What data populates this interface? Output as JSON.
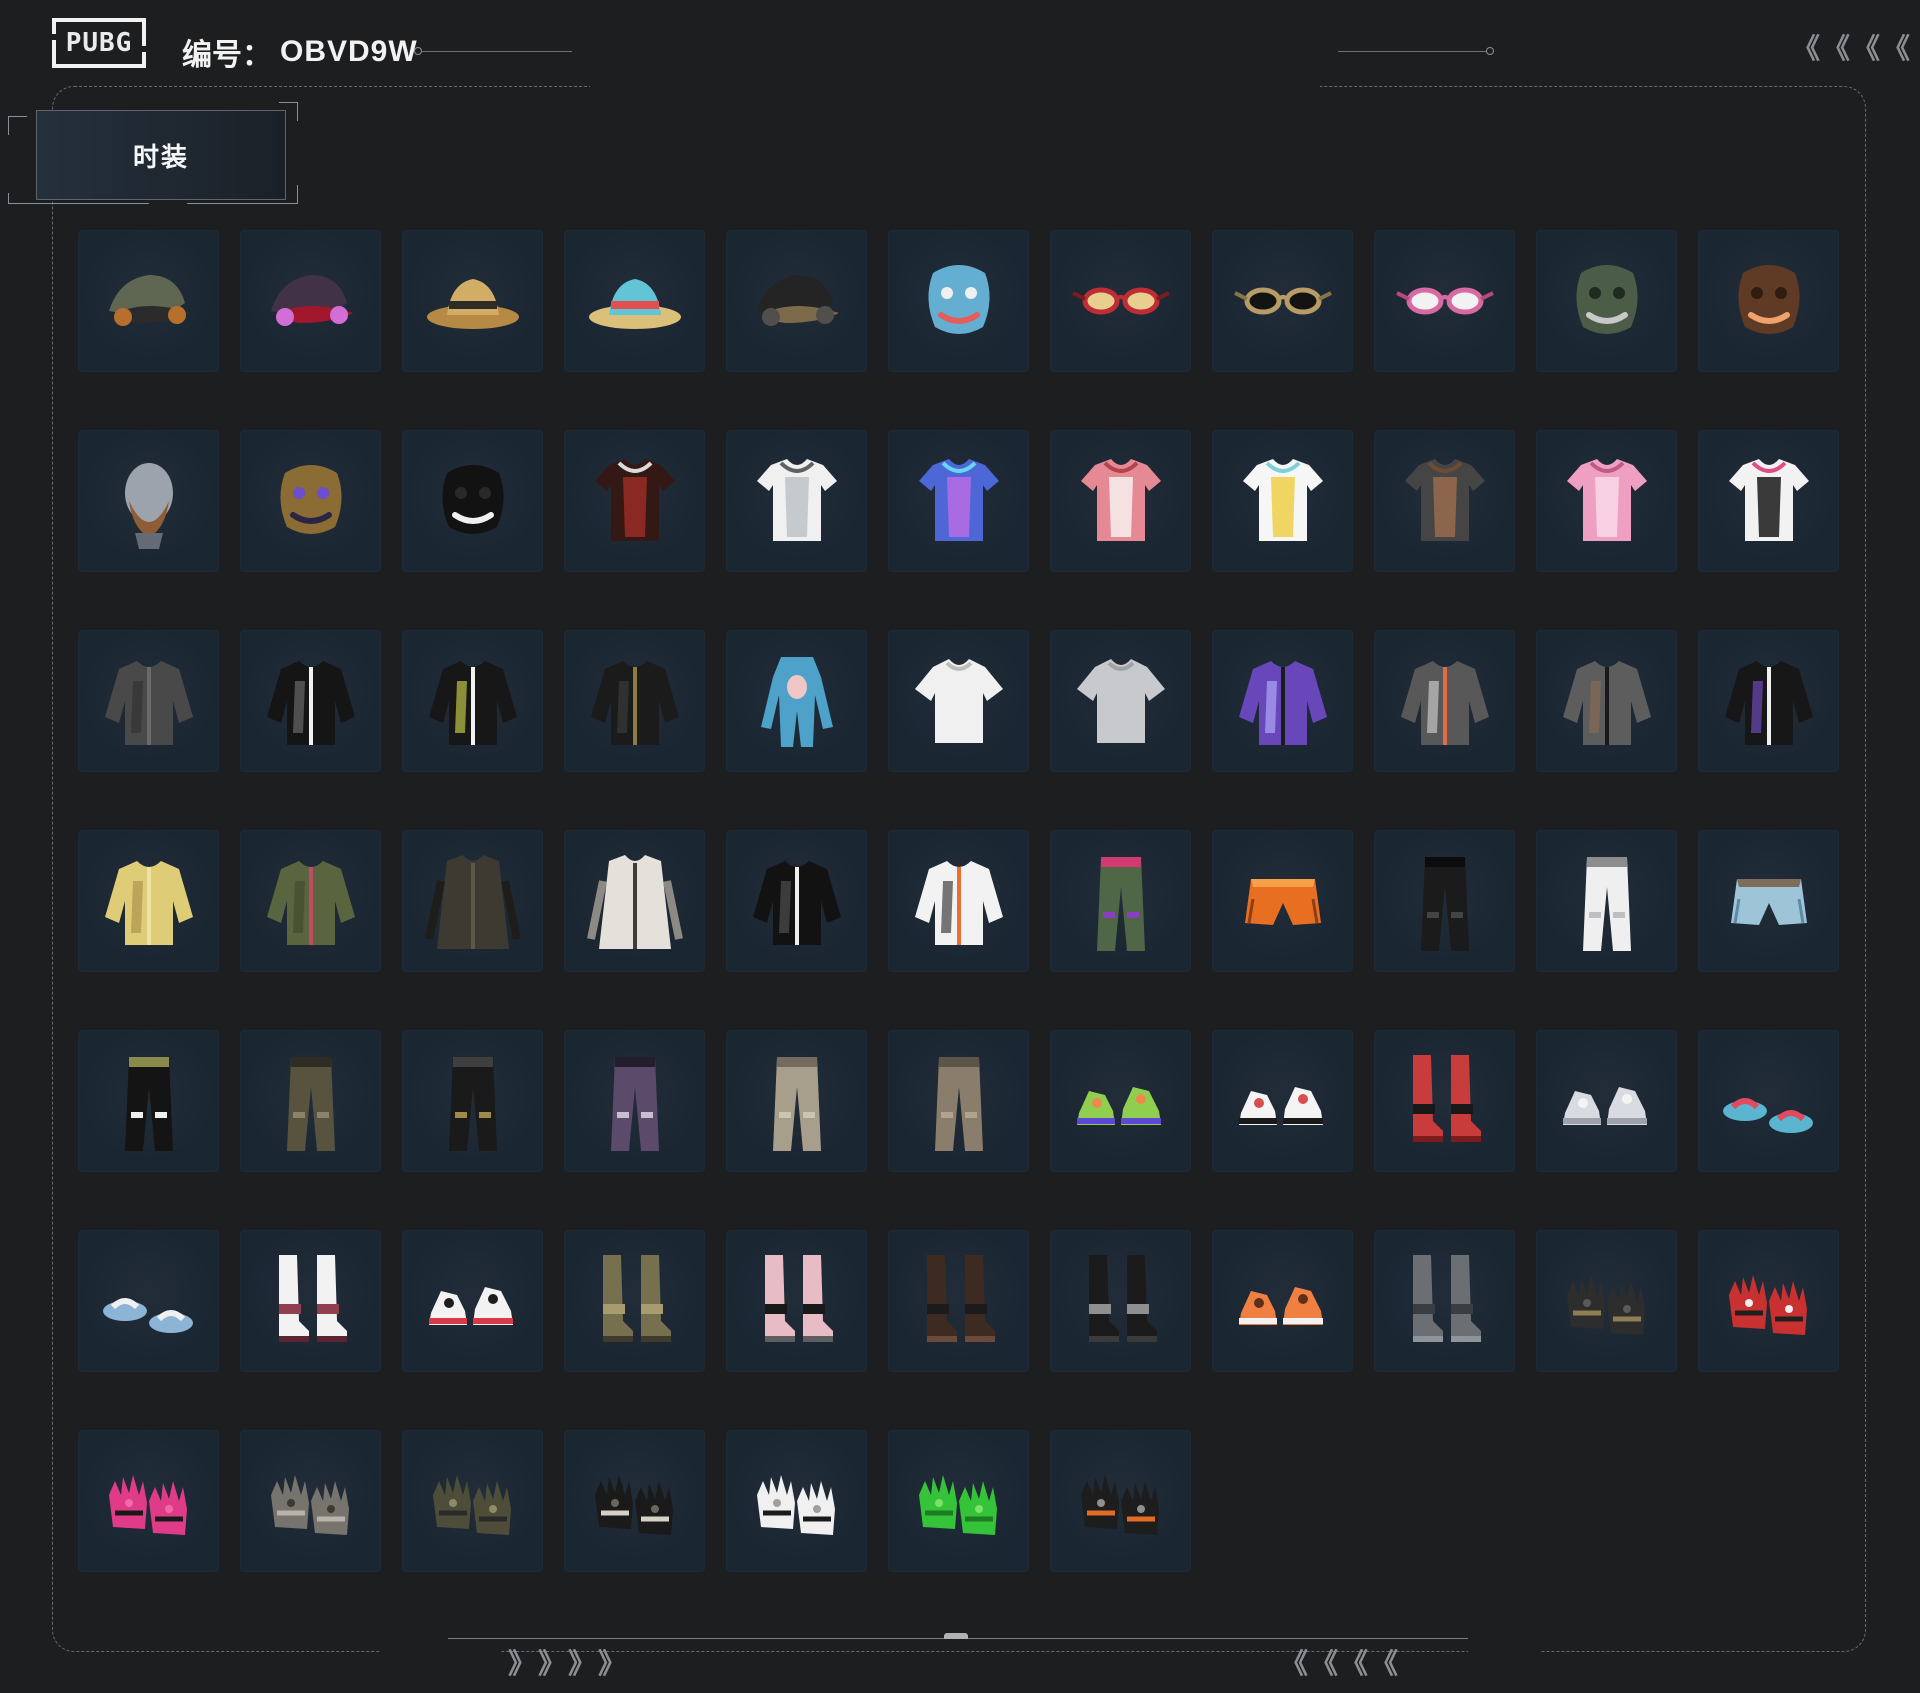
{
  "header": {
    "logo_text": "PUBG",
    "account_label": "编号：",
    "account_id": "OBVD9W"
  },
  "tabs": [
    {
      "label": "时装",
      "selected": true
    }
  ],
  "colors": {
    "background": "#1d1e20",
    "tile": "#1b2633",
    "frame": "#676a6e",
    "accent_text": "#f2f2f2"
  },
  "decor": {
    "top_right_arrows": [
      "《",
      "《",
      "《",
      "《"
    ],
    "bottom_left_arrows": [
      "》",
      "》",
      "》",
      "》"
    ],
    "bottom_right_arrows": [
      "《",
      "《",
      "《",
      "《"
    ]
  },
  "items": [
    {
      "name": "military-cap-headset-icon",
      "kind": "cap",
      "palette": [
        "#5f6753",
        "#b66f2d",
        "#2b2b2b"
      ]
    },
    {
      "name": "cat-ear-goggles-icon",
      "kind": "cap",
      "palette": [
        "#413245",
        "#d26ed6",
        "#a0172e"
      ]
    },
    {
      "name": "bucket-hat-icon",
      "kind": "hat",
      "palette": [
        "#b68a44",
        "#2e2b28",
        "#d2ad65"
      ]
    },
    {
      "name": "sun-hat-icon",
      "kind": "hat",
      "palette": [
        "#dbc07a",
        "#e14f4f",
        "#61c4d7"
      ]
    },
    {
      "name": "black-cap-icon",
      "kind": "cap",
      "palette": [
        "#242424",
        "#514f4b",
        "#7d6a4b"
      ]
    },
    {
      "name": "dino-mask-icon",
      "kind": "mask",
      "palette": [
        "#64afd1",
        "#e45d5d",
        "#f0f0f0"
      ]
    },
    {
      "name": "red-glasses-icon",
      "kind": "glasses",
      "palette": [
        "#bf2d34",
        "#e8cf90",
        "#7b1d1d"
      ]
    },
    {
      "name": "gold-sunglasses-icon",
      "kind": "glasses",
      "palette": [
        "#b89c66",
        "#131313",
        "#8a7447"
      ]
    },
    {
      "name": "visor-glasses-icon",
      "kind": "glasses",
      "palette": [
        "#d76aa2",
        "#f2f2f2",
        "#b44c78"
      ]
    },
    {
      "name": "face-bandana-icon",
      "kind": "mask",
      "palette": [
        "#4b5d46",
        "#c9c9c9",
        "#1f2b20"
      ]
    },
    {
      "name": "chimp-mask-icon",
      "kind": "mask",
      "palette": [
        "#5f3a24",
        "#f0a26d",
        "#2f1d12"
      ]
    },
    {
      "name": "bearded-head-icon",
      "kind": "head",
      "palette": [
        "#9ca3ad",
        "#8f5c38",
        "#646b75"
      ]
    },
    {
      "name": "horned-mask-icon",
      "kind": "mask",
      "palette": [
        "#8a6c34",
        "#2a2547",
        "#6c4ed1"
      ]
    },
    {
      "name": "teeth-face-mask-icon",
      "kind": "mask",
      "palette": [
        "#121212",
        "#f0f0f0",
        "#292929"
      ]
    },
    {
      "name": "skeleton-hoodie-icon",
      "kind": "top",
      "palette": [
        "#331816",
        "#9a2b26",
        "#dadada"
      ]
    },
    {
      "name": "white-tank-top-icon",
      "kind": "top",
      "palette": [
        "#f0f0f0",
        "#bfc3c6",
        "#5f6164"
      ]
    },
    {
      "name": "puffer-vest-icon",
      "kind": "top",
      "palette": [
        "#4d67d6",
        "#b86ce3",
        "#6ad7f1"
      ]
    },
    {
      "name": "checkered-swimsuit-icon",
      "kind": "top",
      "palette": [
        "#e58a94",
        "#f8f0f0",
        "#b2434f"
      ]
    },
    {
      "name": "yellow-shirt-icon",
      "kind": "top",
      "palette": [
        "#f6f6f6",
        "#f0cf48",
        "#7fd0d8"
      ]
    },
    {
      "name": "tattoo-shirt-icon",
      "kind": "top",
      "palette": [
        "#454545",
        "#9a6a4d",
        "#6f4b36"
      ]
    },
    {
      "name": "pink-school-uniform-icon",
      "kind": "top",
      "palette": [
        "#ef9fc2",
        "#f8d8e8",
        "#bb5d86"
      ]
    },
    {
      "name": "crop-top-icon",
      "kind": "top",
      "palette": [
        "#f2f2f2",
        "#1a1a1a",
        "#df4c86"
      ]
    },
    {
      "name": "gray-jacket-icon",
      "kind": "jacket",
      "palette": [
        "#494949",
        "#6a6a6a",
        "#2f2f2f"
      ]
    },
    {
      "name": "maid-outfit-icon",
      "kind": "jacket",
      "palette": [
        "#151515",
        "#f0f0f0",
        "#777"
      ]
    },
    {
      "name": "black-white-shirt-icon",
      "kind": "jacket",
      "palette": [
        "#171717",
        "#f1f1f1",
        "#d8e04a"
      ]
    },
    {
      "name": "black-tie-shirt-icon",
      "kind": "jacket",
      "palette": [
        "#1b1b1b",
        "#8d7c3f",
        "#404040"
      ]
    },
    {
      "name": "blue-onesie-icon",
      "kind": "onesie",
      "palette": [
        "#4ea1c8",
        "#f0c6c6",
        "#2b6f8d"
      ]
    },
    {
      "name": "white-tee-icon",
      "kind": "tee",
      "palette": [
        "#f0f0f0",
        "#bcbcbc",
        "#8b8b8b"
      ]
    },
    {
      "name": "gray-tee-icon",
      "kind": "tee",
      "palette": [
        "#c7c9cc",
        "#9fa2a6",
        "#727579"
      ]
    },
    {
      "name": "purple-jacket-icon",
      "kind": "jacket",
      "palette": [
        "#6847bb",
        "#1c1c1c",
        "#b9b9ff"
      ]
    },
    {
      "name": "orange-bomber-icon",
      "kind": "jacket",
      "palette": [
        "#585858",
        "#e36c46",
        "#d9d9d9"
      ]
    },
    {
      "name": "gray-vest-hoodie-icon",
      "kind": "jacket",
      "palette": [
        "#5d5d5d",
        "#1a1a1a",
        "#8e6d54"
      ]
    },
    {
      "name": "white-black-jacket-icon",
      "kind": "jacket",
      "palette": [
        "#171717",
        "#f0f0f0",
        "#7b54d4"
      ]
    },
    {
      "name": "yellow-fuzzy-coat-icon",
      "kind": "jacket",
      "palette": [
        "#dfcc77",
        "#efe0a5",
        "#a48b45"
      ]
    },
    {
      "name": "green-bomber-icon",
      "kind": "jacket",
      "palette": [
        "#58653f",
        "#c24b61",
        "#3d472b"
      ]
    },
    {
      "name": "long-dark-coat-icon",
      "kind": "coat",
      "palette": [
        "#3d3a31",
        "#5d574a",
        "#1e1d19"
      ]
    },
    {
      "name": "white-trench-coat-icon",
      "kind": "coat",
      "palette": [
        "#e4e1db",
        "#403d39",
        "#8d8a85"
      ]
    },
    {
      "name": "black-hoodie-icon",
      "kind": "jacket",
      "palette": [
        "#121212",
        "#efefef",
        "#595959"
      ]
    },
    {
      "name": "white-orange-jacket-icon",
      "kind": "jacket",
      "palette": [
        "#f2f2f2",
        "#e86f31",
        "#222"
      ]
    },
    {
      "name": "green-shorts-icon",
      "kind": "pants",
      "palette": [
        "#4f6647",
        "#8a3fc2",
        "#d13b70"
      ]
    },
    {
      "name": "orange-shorts-icon",
      "kind": "shorts",
      "palette": [
        "#e86e21",
        "#f6a04a",
        "#8e3e13"
      ]
    },
    {
      "name": "black-pants-icon",
      "kind": "pants",
      "palette": [
        "#1b1b1b",
        "#434343",
        "#0c0c0c"
      ]
    },
    {
      "name": "white-cargo-pants-icon",
      "kind": "pants",
      "palette": [
        "#efefef",
        "#bfbfbf",
        "#8d8d8d"
      ]
    },
    {
      "name": "denim-shorts-icon",
      "kind": "shorts",
      "palette": [
        "#9ec4d8",
        "#7d6d5a",
        "#5d8aa5"
      ]
    },
    {
      "name": "chaps-pants-icon",
      "kind": "pants",
      "palette": [
        "#141414",
        "#efefef",
        "#8a8a4d"
      ]
    },
    {
      "name": "camo-pants-icon",
      "kind": "pants",
      "palette": [
        "#57533f",
        "#8b846b",
        "#2f2d23"
      ]
    },
    {
      "name": "dark-gold-pants-icon",
      "kind": "pants",
      "palette": [
        "#1a1a1a",
        "#9f8a47",
        "#3f3f3f"
      ]
    },
    {
      "name": "purple-camo-pants-icon",
      "kind": "pants",
      "palette": [
        "#5b4a6a",
        "#c7bfd1",
        "#241d2e"
      ]
    },
    {
      "name": "beige-pants-icon",
      "kind": "pants",
      "palette": [
        "#a79f8c",
        "#cbc4b0",
        "#726b5e"
      ]
    },
    {
      "name": "tan-pants-icon",
      "kind": "pants",
      "palette": [
        "#8b7d6b",
        "#b2a38e",
        "#5e5447"
      ]
    },
    {
      "name": "colorful-sneakers-icon",
      "kind": "shoes",
      "palette": [
        "#8fce4e",
        "#5b48d6",
        "#f1894e"
      ]
    },
    {
      "name": "white-sneakers-icon",
      "kind": "shoes",
      "palette": [
        "#f4f4f4",
        "#1a1a1a",
        "#d84d4d"
      ]
    },
    {
      "name": "red-stockings-boots-icon",
      "kind": "boots",
      "palette": [
        "#c83c3c",
        "#181818",
        "#7e1c1c"
      ]
    },
    {
      "name": "winged-sneakers-icon",
      "kind": "shoes",
      "palette": [
        "#d8dce2",
        "#9da2aa",
        "#f4f4f4"
      ]
    },
    {
      "name": "blue-slippers-icon",
      "kind": "slippers",
      "palette": [
        "#5bb5d0",
        "#e14b60",
        "#2f7288"
      ]
    },
    {
      "name": "tiny-slippers-icon",
      "kind": "slippers",
      "palette": [
        "#8cb4d6",
        "#f0f0f0",
        "#394c66"
      ]
    },
    {
      "name": "maryjane-shoes-icon",
      "kind": "boots",
      "palette": [
        "#f2f2f2",
        "#8f3f4d",
        "#5b2430"
      ]
    },
    {
      "name": "white-red-sneakers-icon",
      "kind": "shoes",
      "palette": [
        "#f2f2f2",
        "#d93a48",
        "#1d1d1d"
      ]
    },
    {
      "name": "olive-boots-icon",
      "kind": "boots",
      "palette": [
        "#77704f",
        "#a89c6e",
        "#3f3b2c"
      ]
    },
    {
      "name": "pink-socks-boots-icon",
      "kind": "boots",
      "palette": [
        "#e7bcc4",
        "#181818",
        "#5e5e5e"
      ]
    },
    {
      "name": "dark-boots-icon",
      "kind": "boots",
      "palette": [
        "#3d2b22",
        "#1b1b1b",
        "#6b4a3c"
      ]
    },
    {
      "name": "fur-boots-icon",
      "kind": "boots",
      "palette": [
        "#1b1b1b",
        "#8f8f8f",
        "#3b3b3b"
      ]
    },
    {
      "name": "orange-hiking-boots-icon",
      "kind": "shoes",
      "palette": [
        "#f08042",
        "#f2f2f2",
        "#5e2f19"
      ]
    },
    {
      "name": "gray-boots-icon",
      "kind": "boots",
      "palette": [
        "#6b6f74",
        "#3a3d42",
        "#8f949a"
      ]
    },
    {
      "name": "tactical-gloves-icon",
      "kind": "gloves",
      "palette": [
        "#2d2d2d",
        "#8f7d53",
        "#5a5a5a"
      ]
    },
    {
      "name": "red-moto-gloves-icon",
      "kind": "gloves",
      "palette": [
        "#c93030",
        "#1f1f1f",
        "#efefef"
      ]
    },
    {
      "name": "pink-gloves-icon",
      "kind": "gloves",
      "palette": [
        "#e03b89",
        "#191919",
        "#f06aa8"
      ]
    },
    {
      "name": "gray-gloves-icon",
      "kind": "gloves",
      "palette": [
        "#77736d",
        "#b8b2a8",
        "#3d3a35"
      ]
    },
    {
      "name": "olive-fingerless-gloves-icon",
      "kind": "gloves",
      "palette": [
        "#4e4d39",
        "#2a2a2a",
        "#8f8b67"
      ]
    },
    {
      "name": "skeleton-gloves-icon",
      "kind": "gloves",
      "palette": [
        "#1a1a1a",
        "#d7d1c5",
        "#6b665c"
      ]
    },
    {
      "name": "white-cuffs-icon",
      "kind": "gloves",
      "palette": [
        "#f0f0f0",
        "#1a1a1a",
        "#9f9f9f"
      ]
    },
    {
      "name": "green-gloves-icon",
      "kind": "gloves",
      "palette": [
        "#35c33a",
        "#1d7d23",
        "#7ce26a"
      ]
    },
    {
      "name": "orange-moto-gloves-icon",
      "kind": "gloves",
      "palette": [
        "#1d1d1d",
        "#e06d23",
        "#8f8f8f"
      ]
    }
  ]
}
